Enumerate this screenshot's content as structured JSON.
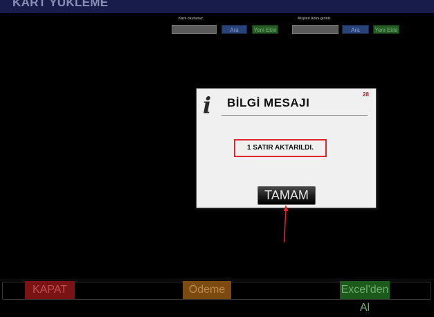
{
  "window": {
    "title": "KART YÜKLEME"
  },
  "card_search": {
    "label": "Kartı okutunuz",
    "value": "",
    "search_button": "Ara",
    "add_button": "Yeni Ekle"
  },
  "customer_search": {
    "label": "Müşteri Adını giriniz",
    "value": "",
    "search_button": "Ara",
    "add_button": "Yeni Ekle"
  },
  "dialog": {
    "icon": "info-icon",
    "icon_glyph": "i",
    "title": "BİLGİ MESAJI",
    "countdown": "28",
    "message": "1 SATIR AKTARILDI.",
    "ok_button": "TAMAM"
  },
  "footer": {
    "close_button": "KAPAT",
    "payment_button": "Ödeme",
    "excel_button": "Excel'den Al"
  },
  "colors": {
    "titlebar": "#181c4a",
    "highlight": "#e0252b",
    "close": "#7a1414",
    "payment": "#7a4a10",
    "excel": "#1c5a1c"
  }
}
